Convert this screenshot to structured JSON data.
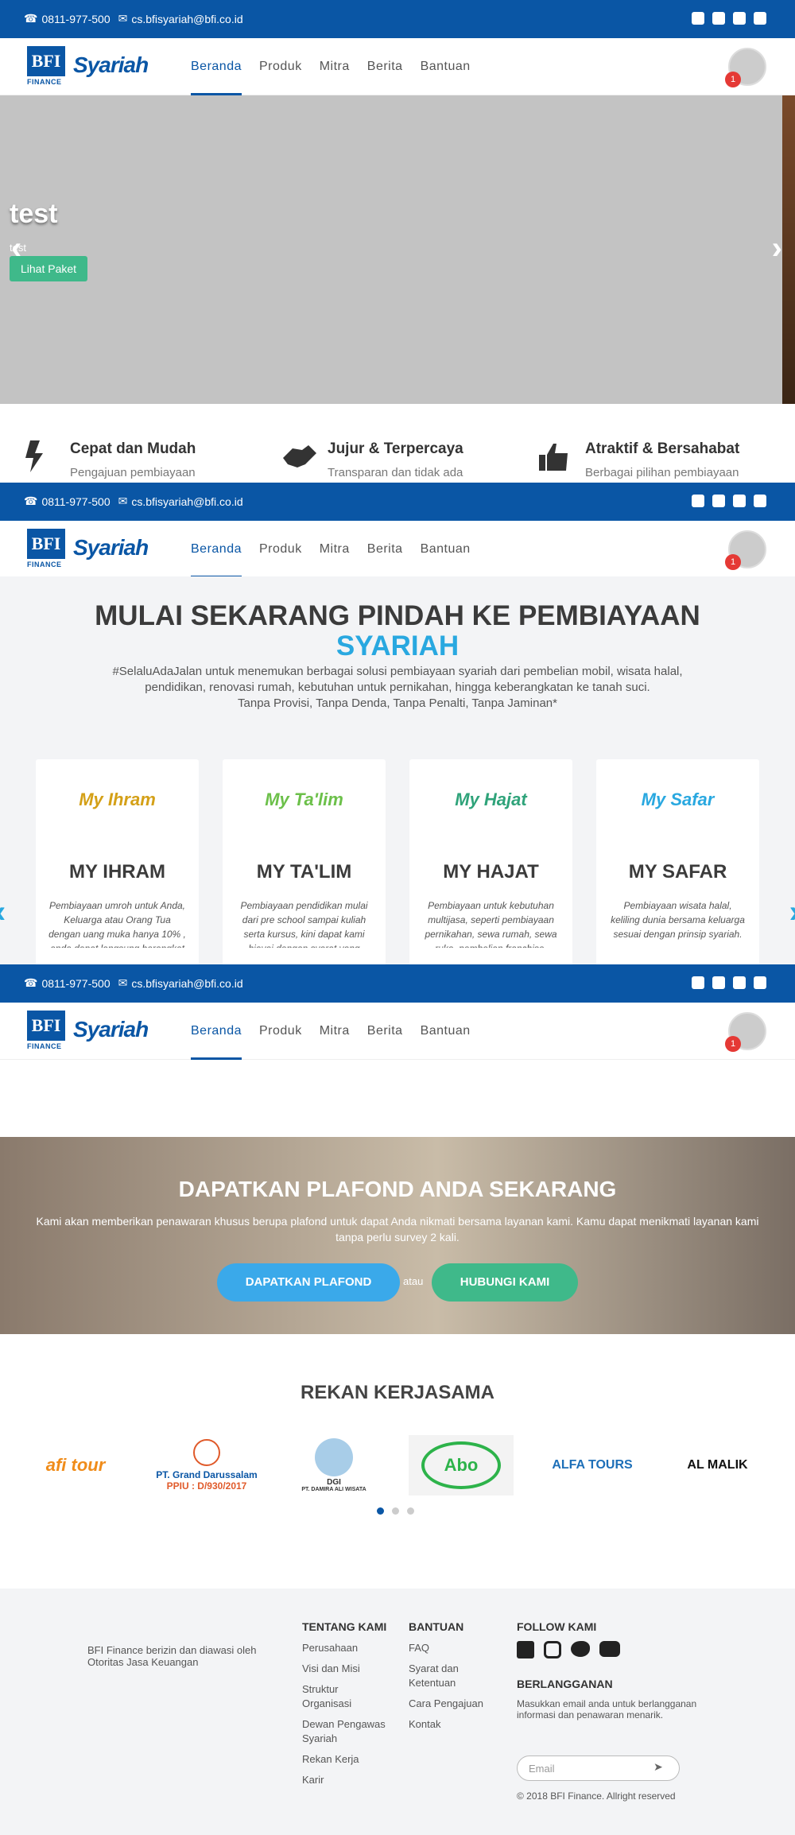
{
  "topbar": {
    "phone": "0811-977-500",
    "email": "cs.bfisyariah@bfi.co.id"
  },
  "brand": {
    "bfi": "BFI",
    "finance": "FINANCE",
    "syariah": "Syariah"
  },
  "nav": {
    "items": [
      "Beranda",
      "Produk",
      "Mitra",
      "Berita",
      "Bantuan"
    ],
    "active": "Beranda",
    "notif_count": "1"
  },
  "hero": {
    "title": "test",
    "subtitle": "test",
    "button": "Lihat Paket"
  },
  "features": [
    {
      "title": "Cepat dan Mudah",
      "desc": "Pengajuan pembiayaan"
    },
    {
      "title": "Jujur & Terpercaya",
      "desc": "Transparan dan tidak ada"
    },
    {
      "title": "Atraktif & Bersahabat",
      "desc": "Berbagai pilihan pembiayaan"
    }
  ],
  "mulai": {
    "title": "MULAI SEKARANG PINDAH KE PEMBIAYAAN",
    "title_highlight": "SYARIAH",
    "desc": "#SelaluAdaJalan untuk menemukan berbagai solusi pembiayaan syariah dari pembelian mobil, wisata halal, pendidikan, renovasi rumah, kebutuhan untuk pernikahan, hingga keberangkatan ke tanah suci.",
    "desc2": "Tanpa Provisi, Tanpa Denda, Tanpa Penalti, Tanpa Jaminan*"
  },
  "products": [
    {
      "brand": "My Ihram",
      "title": "MY IHRAM",
      "desc": "Pembiayaan umroh untuk Anda, Keluarga atau Orang Tua dengan uang muka hanya 10% , anda dapat langsung berangkat tanpa menunggu lugas."
    },
    {
      "brand": "My Ta'lim",
      "title": "MY TA'LIM",
      "desc": "Pembiayaan pendidikan mulai dari pre school sampai kuliah serta kursus, kini dapat kami biayai dengan syarat yang mudah."
    },
    {
      "brand": "My Hajat",
      "title": "MY HAJAT",
      "desc": "Pembiayaan untuk kebutuhan multijasa, seperti pembiayaan pernikahan, sewa rumah, sewa ruko, pembelian franchise, renovasi rumah dan lainnya."
    },
    {
      "brand": "My Safar",
      "title": "MY SAFAR",
      "desc": "Pembiayaan wisata halal, keliling dunia bersama keluarga sesuai dengan prinsip syariah."
    }
  ],
  "plafond": {
    "title": "DAPATKAN PLAFOND ANDA SEKARANG",
    "desc": "Kami akan memberikan penawaran khusus berupa plafond untuk dapat Anda nikmati bersama layanan kami. Kamu dapat menikmati layanan kami tanpa perlu survey 2 kali.",
    "btn1": "DAPATKAN PLAFOND",
    "or": "atau",
    "btn2": "HUBUNGI KAMI"
  },
  "rekan": {
    "title": "REKAN KERJASAMA",
    "partners": [
      "afi tour",
      "PT. Grand Darussalam",
      "PPIU : D/930/2017",
      "DGI",
      "PT. DAMIRA ALI WISATA",
      "Abo",
      "ALFA TOURS",
      "AL MALIK"
    ]
  },
  "footer": {
    "about": "BFI Finance berizin dan diawasi oleh Otoritas Jasa Keuangan",
    "tentang_title": "TENTANG KAMI",
    "tentang": [
      "Perusahaan",
      "Visi dan Misi",
      "Struktur Organisasi",
      "Dewan Pengawas Syariah",
      "Rekan Kerja",
      "Karir"
    ],
    "bantuan_title": "BANTUAN",
    "bantuan": [
      "FAQ",
      "Syarat dan Ketentuan",
      "Cara Pengajuan",
      "Kontak"
    ],
    "follow_title": "FOLLOW KAMI",
    "subscribe_title": "BERLANGGANAN",
    "subscribe_desc": "Masukkan email anda untuk berlangganan informasi dan penawaran menarik.",
    "email_placeholder": "Email",
    "copyright": "© 2018 BFI Finance. Allright reserved"
  },
  "colors": {
    "primary": "#0a56a5",
    "accent": "#29a8e0",
    "green": "#3fb98a"
  }
}
